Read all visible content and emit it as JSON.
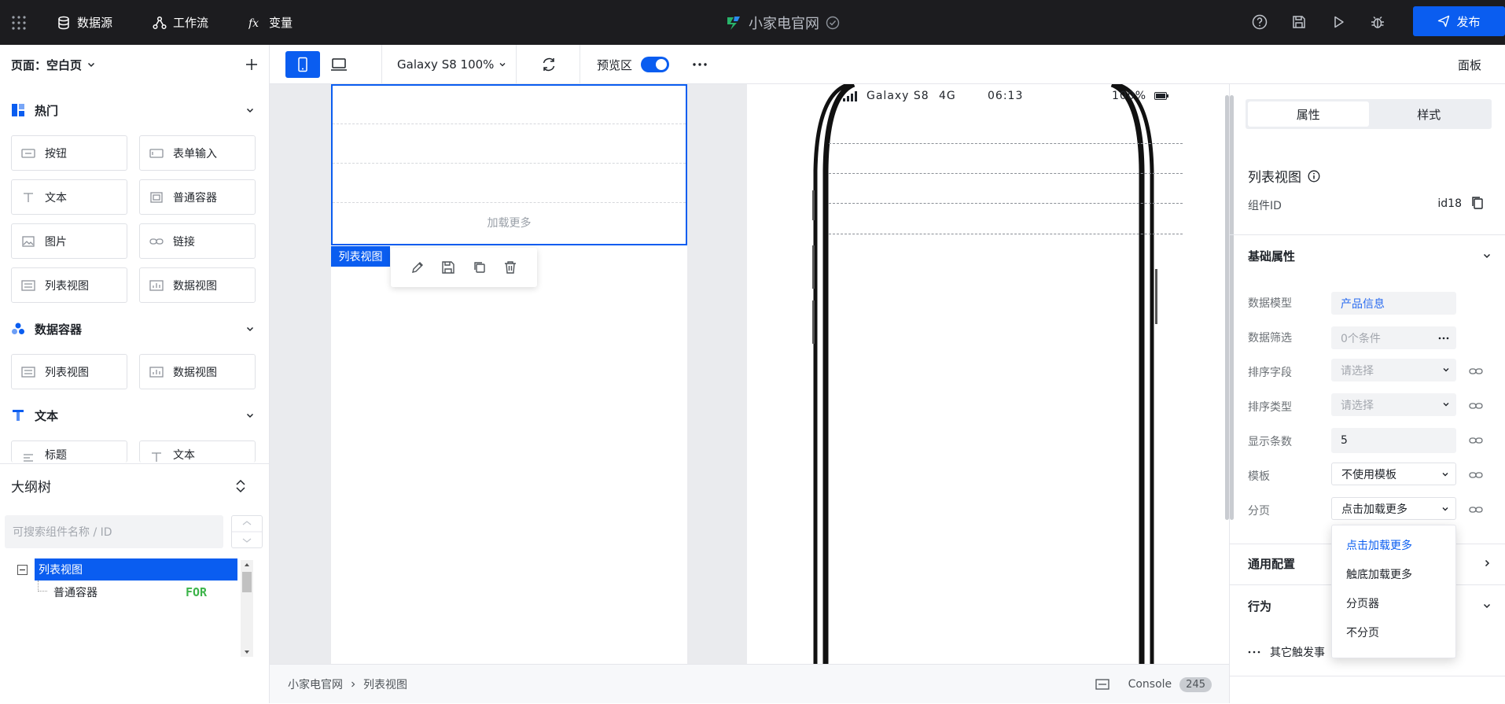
{
  "topbar": {
    "nav": [
      {
        "label": "数据源",
        "icon": "database-icon"
      },
      {
        "label": "工作流",
        "icon": "workflow-icon"
      },
      {
        "label": "变量",
        "icon": "fx-icon"
      }
    ],
    "app_title": "小家电官网",
    "publish_label": "发布",
    "right_icons": [
      "help-icon",
      "save-icon",
      "play-icon",
      "debug-icon"
    ]
  },
  "left": {
    "page_label": "页面：空白页",
    "sections": [
      {
        "title": "热门",
        "items": [
          "按钮",
          "表单输入",
          "文本",
          "普通容器",
          "图片",
          "链接",
          "列表视图",
          "数据视图"
        ]
      },
      {
        "title": "数据容器",
        "items": [
          "列表视图",
          "数据视图"
        ]
      },
      {
        "title": "文本",
        "items": [
          "标题",
          "文本"
        ]
      }
    ],
    "outline_title": "大纲树",
    "outline_search_placeholder": "可搜索组件名称 / ID",
    "tree": {
      "root": "列表视图",
      "child": "普通容器",
      "child_badge": "FOR"
    }
  },
  "toolbar": {
    "device_label": "Galaxy S8 100%",
    "preview_label": "预览区",
    "preview_on": true,
    "panel_label": "面板"
  },
  "canvas": {
    "load_more": "加载更多",
    "selected_tag": "列表视图",
    "phone": {
      "carrier": "Galaxy S8",
      "network": "4G",
      "time": "06:13",
      "battery": "100%"
    }
  },
  "bottom": {
    "breadcrumb": [
      "小家电官网",
      "列表视图"
    ],
    "console_label": "Console",
    "console_count": "245"
  },
  "right": {
    "tabs": [
      {
        "label": "属性",
        "active": true
      },
      {
        "label": "样式",
        "active": false
      }
    ],
    "component_name": "列表视图",
    "component_id_label": "组件ID",
    "component_id": "id18",
    "basic_group": "基础属性",
    "props": [
      {
        "label": "数据模型",
        "value": "产品信息"
      },
      {
        "label": "数据筛选",
        "value": "0个条件"
      },
      {
        "label": "排序字段",
        "value": "请选择"
      },
      {
        "label": "排序类型",
        "value": "请选择"
      },
      {
        "label": "显示条数",
        "value": "5"
      },
      {
        "label": "模板",
        "value": "不使用模板"
      },
      {
        "label": "分页",
        "value": "点击加载更多"
      }
    ],
    "general_group": "通用配置",
    "behavior_group": "行为",
    "other_events": "其它触发事",
    "pagination_options": [
      {
        "label": "点击加载更多",
        "selected": true
      },
      {
        "label": "触底加载更多",
        "selected": false
      },
      {
        "label": "分页器",
        "selected": false
      },
      {
        "label": "不分页",
        "selected": false
      }
    ]
  },
  "colors": {
    "accent": "#0a5df0",
    "topbar": "#1c1c1f",
    "for_badge": "#3cb44a"
  }
}
